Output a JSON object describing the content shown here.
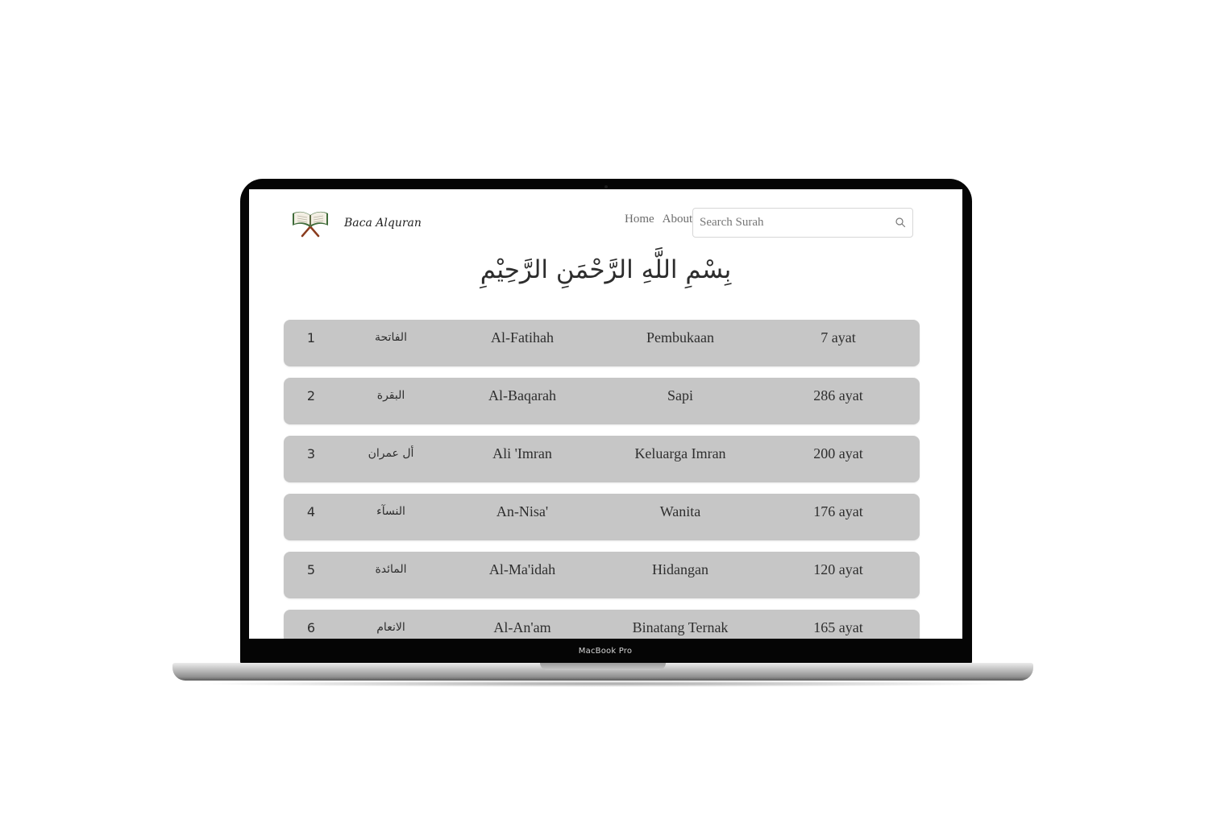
{
  "device": {
    "bezel_label": "MacBook Pro"
  },
  "navbar": {
    "brand": "Baca Alquran",
    "links": [
      "Home",
      "About"
    ],
    "search_placeholder": "Search Surah"
  },
  "basmala": "بِسْمِ اللَّهِ الرَّحْمَنِ الرَّحِيْمِ",
  "surahs": [
    {
      "number": "1",
      "arabic": "الفاتحة",
      "latin": "Al-Fatihah",
      "meaning": "Pembukaan",
      "ayat": "7 ayat"
    },
    {
      "number": "2",
      "arabic": "البقرة",
      "latin": "Al-Baqarah",
      "meaning": "Sapi",
      "ayat": "286 ayat"
    },
    {
      "number": "3",
      "arabic": "أل عمران",
      "latin": "Ali 'Imran",
      "meaning": "Keluarga Imran",
      "ayat": "200 ayat"
    },
    {
      "number": "4",
      "arabic": "النسآء",
      "latin": "An-Nisa'",
      "meaning": "Wanita",
      "ayat": "176 ayat"
    },
    {
      "number": "5",
      "arabic": "المائدة",
      "latin": "Al-Ma'idah",
      "meaning": "Hidangan",
      "ayat": "120 ayat"
    },
    {
      "number": "6",
      "arabic": "الانعام",
      "latin": "Al-An'am",
      "meaning": "Binatang Ternak",
      "ayat": "165 ayat"
    }
  ]
}
